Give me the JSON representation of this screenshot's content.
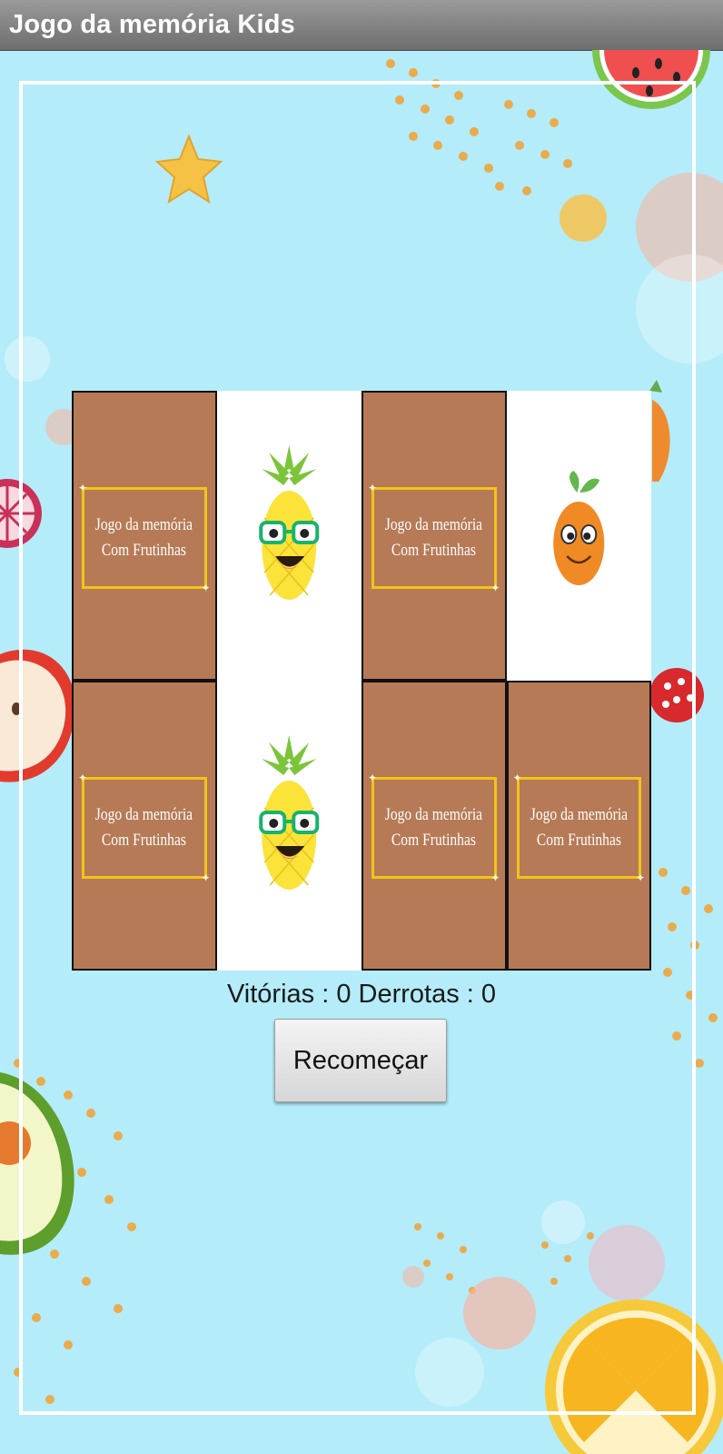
{
  "app": {
    "title": "Jogo da memória Kids"
  },
  "board": {
    "cards": [
      {
        "state": "back",
        "label": "Jogo da memória\nCom Frutinhas"
      },
      {
        "state": "front",
        "fruit": "pineapple-icon"
      },
      {
        "state": "back",
        "label": "Jogo da memória\nCom Frutinhas"
      },
      {
        "state": "front",
        "fruit": "orange-icon"
      },
      {
        "state": "back",
        "label": "Jogo da memória\nCom Frutinhas"
      },
      {
        "state": "front",
        "fruit": "pineapple-icon"
      },
      {
        "state": "back",
        "label": "Jogo da memória\nCom Frutinhas"
      },
      {
        "state": "back",
        "label": "Jogo da memória\nCom Frutinhas"
      }
    ]
  },
  "score": {
    "text": "Vitórias : 0 Derrotas : 0"
  },
  "restart_button": {
    "label": "Recomeçar"
  },
  "colors": {
    "card_back": "#b67a56",
    "card_border": "#f2c417",
    "background": "#b4ecfa"
  }
}
